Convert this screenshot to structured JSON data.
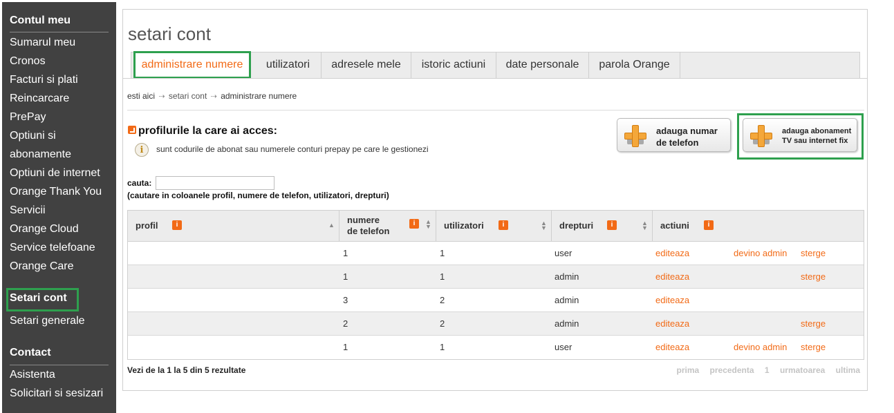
{
  "sidebar": {
    "sections": [
      {
        "heading": "Contul meu",
        "items": [
          "Sumarul meu",
          "Cronos",
          "Facturi si plati",
          "Reincarcare",
          "PrePay",
          "Optiuni si",
          "abonamente",
          "Optiuni de internet",
          "Orange Thank You",
          "Servicii",
          "Orange Cloud",
          "Service telefoane",
          "Orange Care"
        ]
      },
      {
        "heading": "Setari cont",
        "items": [
          "Setari generale"
        ]
      },
      {
        "heading": "Contact",
        "items": [
          "Asistenta",
          "Solicitari si sesizari"
        ]
      }
    ]
  },
  "page": {
    "title": "setari cont"
  },
  "tabs": [
    "administrare numere",
    "utilizatori",
    "adresele mele",
    "istoric actiuni",
    "date personale",
    "parola Orange"
  ],
  "breadcrumb": {
    "prefix": "esti aici",
    "arrow": "⇢",
    "items": [
      "setari cont",
      "administrare numere"
    ]
  },
  "section": {
    "title": "profilurile la care ai acces:",
    "info_icon": "i",
    "description": "sunt codurile de abonat sau numerele conturi prepay pe care le gestionezi"
  },
  "buttons": {
    "add_phone": {
      "line1": "adauga numar",
      "line2": "de telefon"
    },
    "add_sub": {
      "line1": "adauga abonament",
      "line2": "TV sau internet fix"
    }
  },
  "search": {
    "label": "cauta:",
    "value": "",
    "hint": "(cautare in coloanele profil, numere de telefon, utilizatori, drepturi)"
  },
  "table": {
    "info_badge": "i",
    "sort_up": "▲",
    "sort_down": "▼",
    "headers": {
      "profil": "profil",
      "numere1": "numere",
      "numere2": "de telefon",
      "utilizatori": "utilizatori",
      "drepturi": "drepturi",
      "actiuni": "actiuni"
    },
    "rows": [
      {
        "numere": "1",
        "utilizatori": "1",
        "drepturi": "user",
        "edit": "editeaza",
        "admin": "devino admin",
        "delete": "sterge"
      },
      {
        "numere": "1",
        "utilizatori": "1",
        "drepturi": "admin",
        "edit": "editeaza",
        "admin": "",
        "delete": "sterge"
      },
      {
        "numere": "3",
        "utilizatori": "2",
        "drepturi": "admin",
        "edit": "editeaza",
        "admin": "",
        "delete": ""
      },
      {
        "numere": "2",
        "utilizatori": "2",
        "drepturi": "admin",
        "edit": "editeaza",
        "admin": "",
        "delete": "sterge"
      },
      {
        "numere": "1",
        "utilizatori": "1",
        "drepturi": "user",
        "edit": "editeaza",
        "admin": "devino admin",
        "delete": "sterge"
      }
    ]
  },
  "summary": "Vezi de la 1 la 5 din 5 rezultate",
  "pager": {
    "first": "prima",
    "prev": "precedenta",
    "page": "1",
    "next": "urmatoarea",
    "last": "ultima"
  },
  "colors": {
    "accent": "#f26a16",
    "highlight": "#2ea04e",
    "sidebar_bg": "#414141"
  }
}
